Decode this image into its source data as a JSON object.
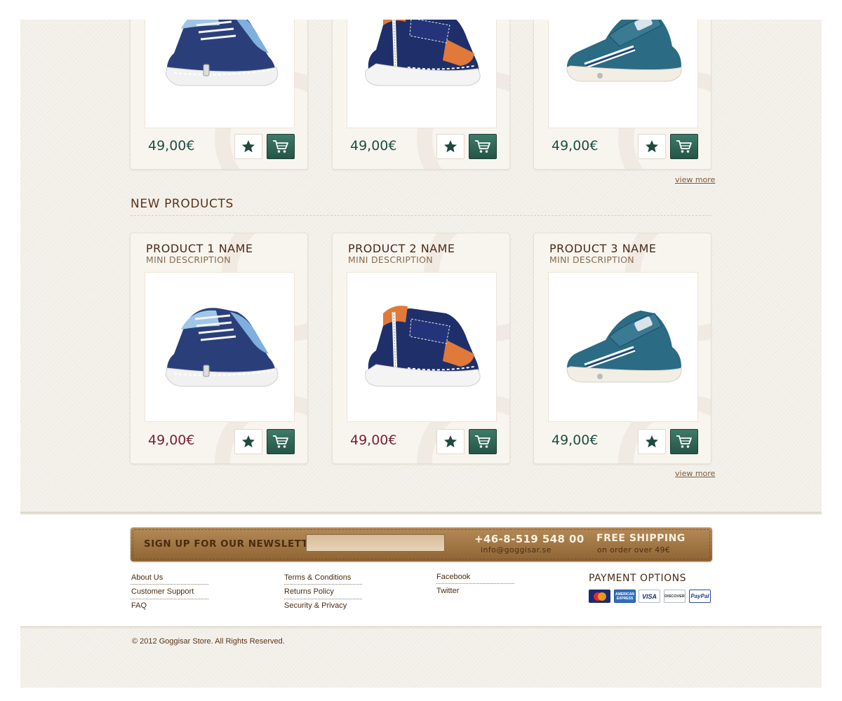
{
  "featured_row": {
    "products": [
      {
        "price": "49,00€"
      },
      {
        "price": "49,00€"
      },
      {
        "price": "49,00€"
      }
    ],
    "view_more_label": "view more"
  },
  "new_products": {
    "title": "NEW PRODUCTS",
    "products": [
      {
        "name": "PRODUCT 1 NAME",
        "description": "MINI DESCRIPTION",
        "price": "49,00€"
      },
      {
        "name": "PRODUCT 2 NAME",
        "description": "MINI DESCRIPTION",
        "price": "49,00€"
      },
      {
        "name": "PRODUCT 3 NAME",
        "description": "MINI DESCRIPTION",
        "price": "49,00€"
      }
    ],
    "view_more_label": "view more"
  },
  "newsletter": {
    "label": "SIGN UP FOR OUR NEWSLETTER:",
    "input_value": "",
    "phone": "+46-8-519 548 00",
    "email": "info@goggisar.se",
    "shipping_title": "FREE SHIPPING",
    "shipping_subtitle": "on order over 49€"
  },
  "footer": {
    "col1": [
      "About Us",
      "Customer Support",
      "FAQ"
    ],
    "col2": [
      "Terms & Conditions",
      "Returns Policy",
      "Security & Privacy"
    ],
    "col3": [
      "Facebook",
      "Twitter"
    ],
    "payment_title": "PAYMENT OPTIONS",
    "payment_cards": [
      "MasterCard",
      "AMERICAN EXPRESS",
      "VISA",
      "DISCOVER",
      "PayPal"
    ],
    "copyright": "© 2012 Goggisar Store. All Rights Reserved."
  },
  "colors": {
    "price_green": "#1e4f44",
    "price_sale": "#7a1f3a",
    "brand_brown": "#4a2c10",
    "cart_green": "#2f6656"
  },
  "icons": [
    "star-icon",
    "cart-icon",
    "shoe-image"
  ]
}
